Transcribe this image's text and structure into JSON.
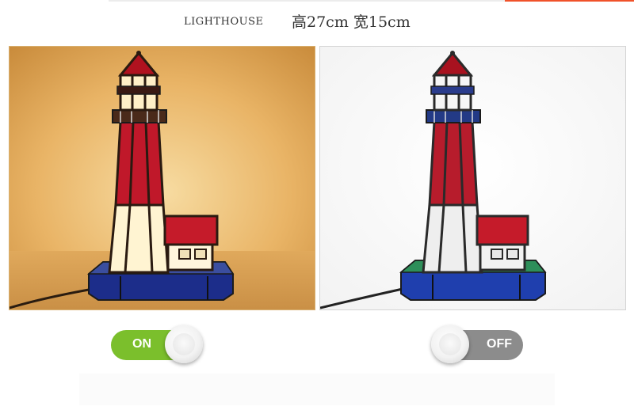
{
  "header": {
    "product_name": "LIGHTHOUSE",
    "dimensions": "高27cm 宽15cm"
  },
  "photos": {
    "lit_state": "on",
    "unlit_state": "off"
  },
  "switches": {
    "on_label": "ON",
    "off_label": "OFF"
  },
  "colors": {
    "accent": "#f0522a",
    "switch_on": "#7bbf2c",
    "switch_off": "#8c8c8c",
    "lit_background": "#f0c27a",
    "glass_red": "#c0182a",
    "glass_blue": "#1f3fae",
    "glass_green": "#2e8f5a"
  }
}
